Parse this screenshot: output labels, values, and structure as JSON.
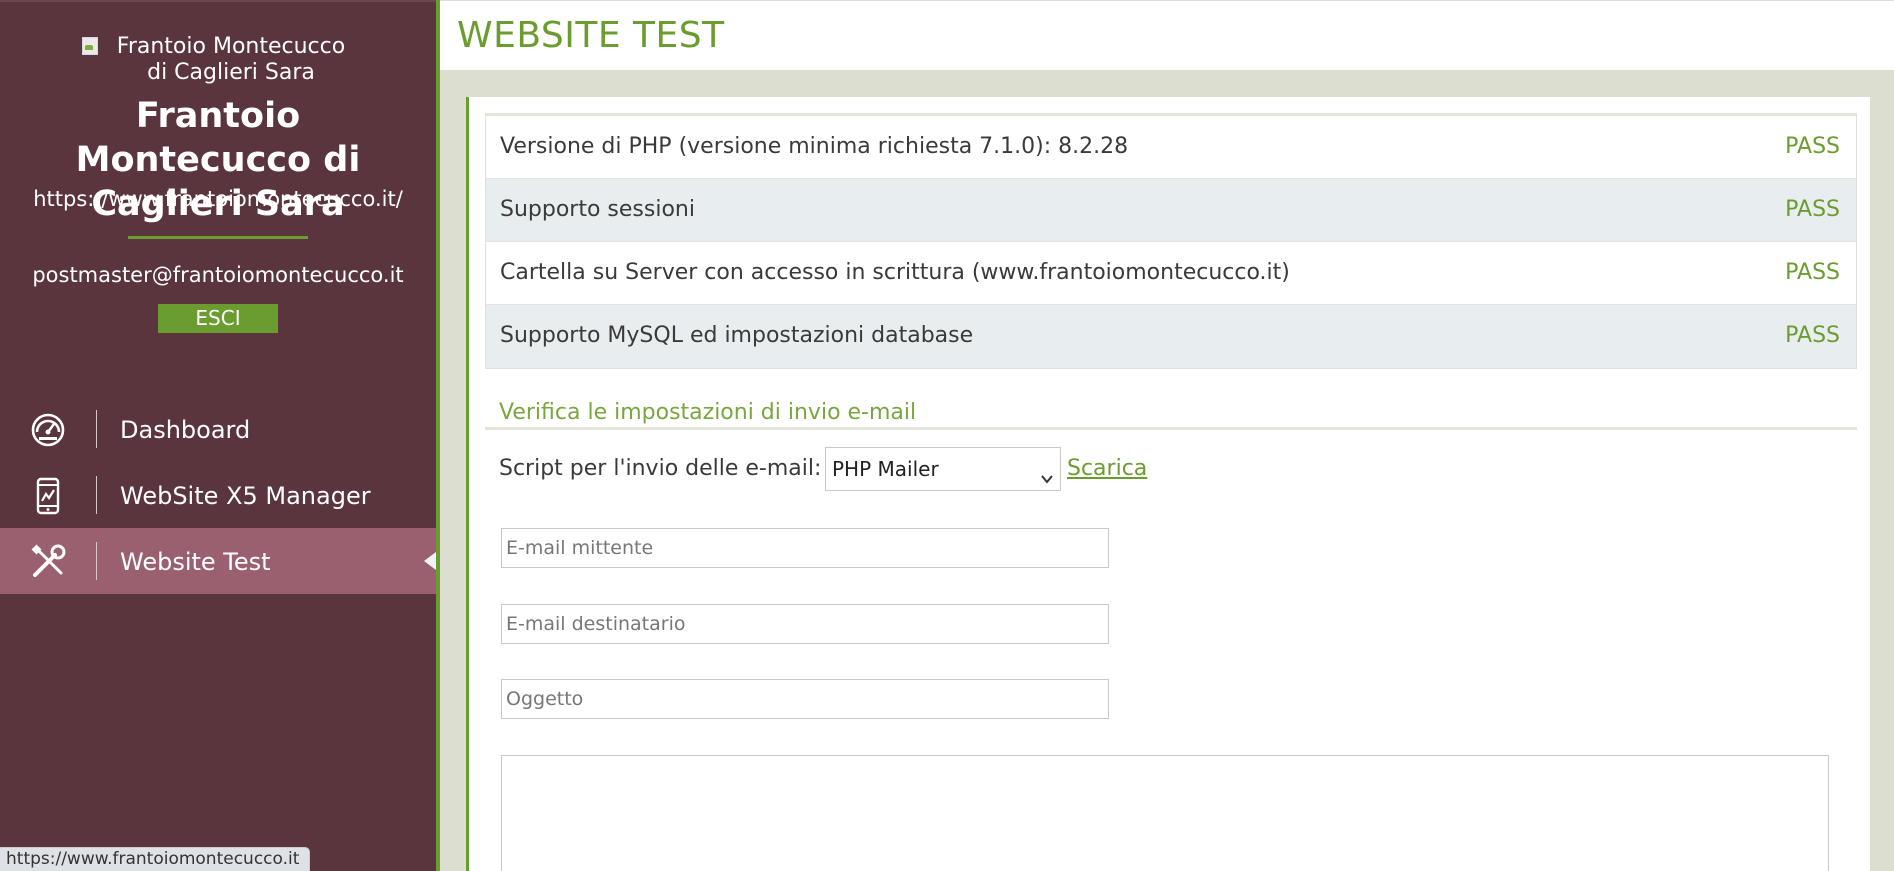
{
  "sidebar": {
    "logo_alt": "Frantoio Montecucco di Caglieri Sara",
    "site_name": "Frantoio Montecucco di Caglieri Sara",
    "site_url": "https://www.frantoiomontecucco.it/",
    "user_email": "postmaster@frantoiomontecucco.it",
    "logout_label": "ESCI",
    "nav": [
      {
        "label": "Dashboard",
        "icon": "gauge-icon"
      },
      {
        "label": "WebSite X5 Manager",
        "icon": "mobile-chart-icon"
      },
      {
        "label": "Website Test",
        "icon": "tools-icon",
        "active": true
      }
    ]
  },
  "header": {
    "title": "WEBSITE TEST"
  },
  "checks": [
    {
      "label": "Versione di PHP (versione minima richiesta 7.1.0): 8.2.28",
      "status": "PASS"
    },
    {
      "label": "Supporto sessioni",
      "status": "PASS"
    },
    {
      "label": "Cartella su Server con accesso in scrittura (www.frantoiomontecucco.it)",
      "status": "PASS"
    },
    {
      "label": "Supporto MySQL ed impostazioni database",
      "status": "PASS"
    }
  ],
  "email_test": {
    "section_title": "Verifica le impostazioni di invio e-mail",
    "script_label": "Script per l'invio delle e-mail:",
    "script_selected": "PHP Mailer",
    "download_label": "Scarica",
    "sender_placeholder": "E-mail mittente",
    "recipient_placeholder": "E-mail destinatario",
    "subject_placeholder": "Oggetto"
  },
  "statusbar": {
    "url": "https://www.frantoiomontecucco.it"
  },
  "colors": {
    "sidebar_bg": "#5a353e",
    "accent": "#6b9c2f",
    "active_nav": "#9b6070"
  }
}
